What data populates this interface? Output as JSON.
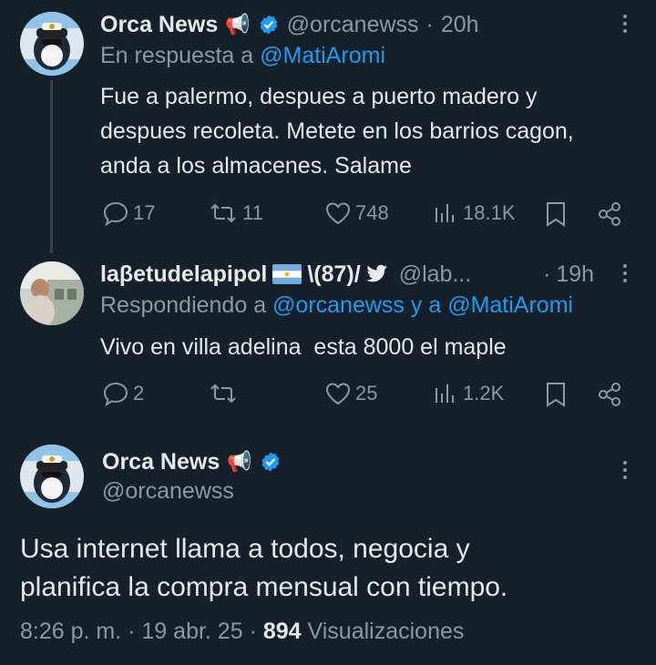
{
  "tweet1": {
    "name": "Orca News",
    "name_emoji": "📢",
    "handle": "@orcanewss",
    "time": "20h",
    "reply_prefix": "En respuesta a",
    "reply_to": "@MatiAromi",
    "text_lines": [
      "Fue a palermo, despues a puerto madero y",
      "despues recoleta. Metete en los barrios cagon,",
      "anda a los almacenes. Salame"
    ],
    "replies": "17",
    "retweets": "11",
    "likes": "748",
    "views": "18.1K"
  },
  "tweet2": {
    "name": "laβetudelapipol",
    "name_extra": "\\(87)/",
    "handle": "@lab...",
    "time": "19h",
    "reply_prefix": "Respondiendo a",
    "reply_to_1": "@orcanewss",
    "reply_join": "y a",
    "reply_to_2": "@MatiAromi",
    "text": "Vivo en villa adelina  esta 8000 el maple",
    "replies": "2",
    "retweets": "",
    "likes": "25",
    "views": "1.2K"
  },
  "main_tweet": {
    "name": "Orca News",
    "name_emoji": "📢",
    "handle": "@orcanewss",
    "text_lines": [
      "Usa internet llama a todos, negocia y",
      "planifica la compra mensual con tiempo."
    ],
    "time": "8:26 p. m.",
    "date": "19 abr. 25",
    "views_count": "894",
    "views_label": "Visualizaciones"
  },
  "colors": {
    "background": "#15202b",
    "accent": "#1d9bf0",
    "muted": "#8b98a5"
  }
}
